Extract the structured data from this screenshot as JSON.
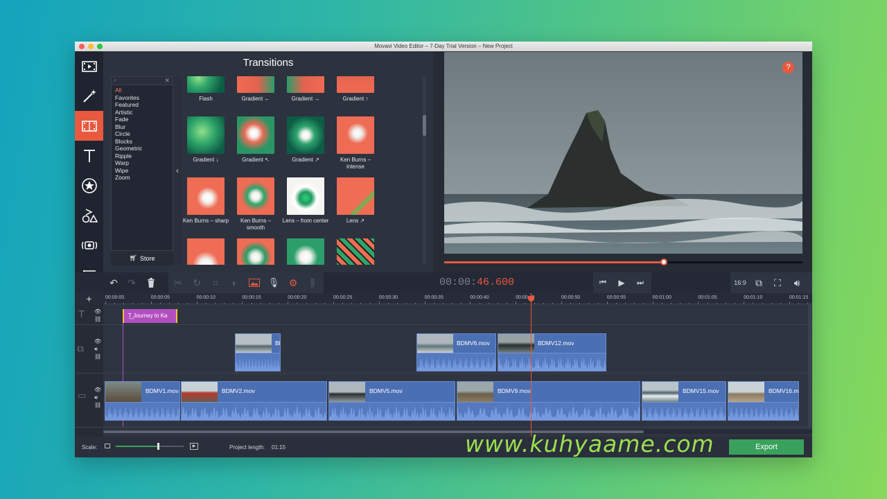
{
  "window": {
    "title": "Movavi Video Editor – 7-Day Trial Version – New Project"
  },
  "sidebar": {
    "items": [
      {
        "icon": "film-import-icon",
        "active": false
      },
      {
        "icon": "magic-wand-icon",
        "active": false
      },
      {
        "icon": "transitions-icon",
        "active": true
      },
      {
        "icon": "titles-icon",
        "active": false
      },
      {
        "icon": "stickers-icon",
        "active": false
      },
      {
        "icon": "shapes-icon",
        "active": false
      },
      {
        "icon": "capture-icon",
        "active": false
      },
      {
        "icon": "menu-icon",
        "active": false
      }
    ]
  },
  "transitions_panel": {
    "title": "Transitions",
    "categories": [
      "All",
      "Favorites",
      "Featured",
      "Artistic",
      "Fade",
      "Blur",
      "Circle",
      "Blocks",
      "Geometric",
      "Ripple",
      "Warp",
      "Wipe",
      "Zoom"
    ],
    "selected_category": "All",
    "store_label": "Store",
    "items": [
      {
        "label": "Flash"
      },
      {
        "label": "Gradient ←"
      },
      {
        "label": "Gradient →"
      },
      {
        "label": "Gradient ↑"
      },
      {
        "label": "Gradient ↓"
      },
      {
        "label": "Gradient ↖"
      },
      {
        "label": "Gradient ↗"
      },
      {
        "label": "Ken Burns – intense"
      },
      {
        "label": "Ken Burns – sharp"
      },
      {
        "label": "Ken Burns – smooth"
      },
      {
        "label": "Lens – from center"
      },
      {
        "label": "Lens ↗"
      },
      {
        "label": ""
      },
      {
        "label": ""
      },
      {
        "label": ""
      },
      {
        "label": ""
      }
    ]
  },
  "preview": {
    "help": "?",
    "progress": 0.615
  },
  "player": {
    "timecode_dim": "00:00:",
    "timecode_active": "46.600",
    "aspect": "16:9"
  },
  "ruler": {
    "ticks": [
      "00:00:00",
      "00:00:05",
      "00:00:10",
      "00:00:15",
      "00:00:20",
      "00:00:25",
      "00:00:30",
      "00:00:35",
      "00:00:40",
      "00:00:45",
      "00:00:50",
      "00:00:55",
      "00:01:00",
      "00:01:05",
      "00:01:10",
      "00:01:15"
    ]
  },
  "tracks": {
    "title_clip": "Journey to Ka",
    "overlay_clips": [
      "Bl",
      "BDMV6.mov",
      "BDMV12.mov"
    ],
    "main_clips": [
      "BDMV1.mov",
      "BDMV2.mov",
      "BDMV5.mov",
      "BDMV9.mov",
      "BDMV15.mov",
      "BDMV16.m"
    ]
  },
  "bottom": {
    "scale_label": "Scale:",
    "project_length_label": "Project length:",
    "project_length": "01:15",
    "export_label": "Export"
  },
  "watermark": "www.kuhyaame.com",
  "colors": {
    "accent": "#e8593f",
    "clip": "#4b6fb3",
    "title_clip": "#b24fbf",
    "export": "#3aa15c"
  }
}
